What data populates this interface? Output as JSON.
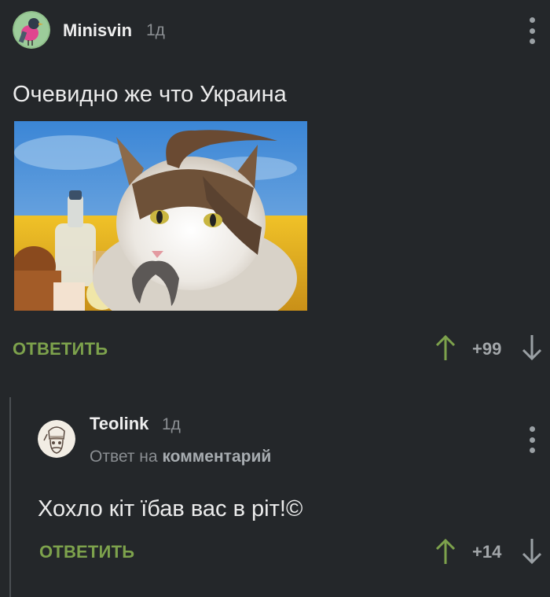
{
  "comment": {
    "author": "Minisvin",
    "time": "1д",
    "text": "Очевидно же что Украина",
    "reply_label": "ОТВЕТИТЬ",
    "score": "+99"
  },
  "reply": {
    "author": "Teolink",
    "time": "1д",
    "reply_to_prefix": "Ответ на",
    "reply_to_target": "комментарий",
    "text": "Хохло кіт їбав вас в ріт!©",
    "reply_label": "ОТВЕТИТЬ",
    "score": "+14"
  },
  "colors": {
    "background": "#24272a",
    "accent_green": "#7da24c",
    "upvote": "#7da24c",
    "downvote": "#9aa0a4"
  },
  "icons": {
    "upvote": "arrow-up-icon",
    "downvote": "arrow-down-icon",
    "menu": "vertical-dots-icon"
  }
}
